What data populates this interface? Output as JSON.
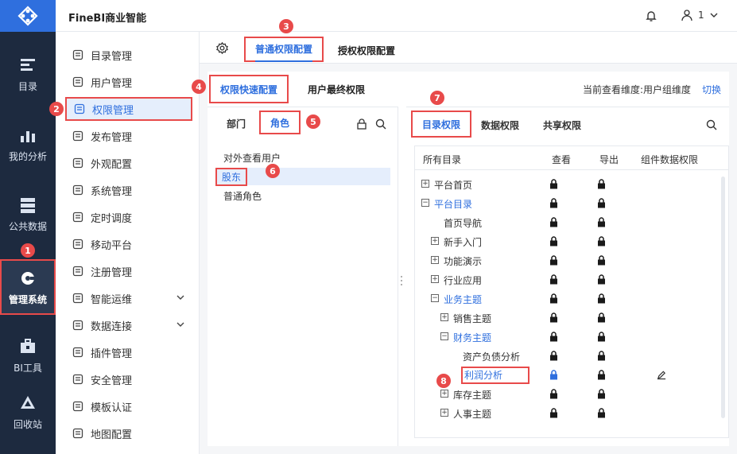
{
  "app": {
    "title": "FineBI商业智能",
    "user": "1"
  },
  "leftnav": [
    {
      "label": "目录",
      "icon": "catalog-icon"
    },
    {
      "label": "我的分析",
      "icon": "analysis-chart-icon"
    },
    {
      "label": "公共数据",
      "icon": "public-data-icon"
    },
    {
      "label": "管理系统",
      "icon": "gear-management-icon"
    },
    {
      "label": "BI工具",
      "icon": "toolbox-icon"
    },
    {
      "label": "回收站",
      "icon": "recycle-icon"
    }
  ],
  "submenu": [
    {
      "label": "目录管理",
      "icon": "catalog-manage-icon"
    },
    {
      "label": "用户管理",
      "icon": "user-icon"
    },
    {
      "label": "权限管理",
      "icon": "permission-shield-icon"
    },
    {
      "label": "发布管理",
      "icon": "publish-icon"
    },
    {
      "label": "外观配置",
      "icon": "appearance-brush-icon"
    },
    {
      "label": "系统管理",
      "icon": "system-gear-icon"
    },
    {
      "label": "定时调度",
      "icon": "timer-icon"
    },
    {
      "label": "移动平台",
      "icon": "mobile-icon"
    },
    {
      "label": "注册管理",
      "icon": "register-icon"
    },
    {
      "label": "智能运维",
      "icon": "ops-icon"
    },
    {
      "label": "数据连接",
      "icon": "link-icon"
    },
    {
      "label": "插件管理",
      "icon": "plugin-icon"
    },
    {
      "label": "安全管理",
      "icon": "security-shield-icon"
    },
    {
      "label": "模板认证",
      "icon": "template-cert-icon"
    },
    {
      "label": "地图配置",
      "icon": "map-icon"
    }
  ],
  "tabs1": {
    "normal": "普通权限配置",
    "grant": "授权权限配置"
  },
  "tabs2": {
    "quick": "权限快速配置",
    "final": "用户最终权限"
  },
  "dimension": {
    "text": "当前查看维度:用户组维度",
    "switch": "切换"
  },
  "lefttabs": {
    "dept": "部门",
    "role": "角色"
  },
  "roles": [
    "对外查看用户",
    "股东",
    "普通角色"
  ],
  "righttabs": {
    "catalog": "目录权限",
    "data": "数据权限",
    "share": "共享权限"
  },
  "treehead": {
    "all": "所有目录",
    "view": "查看",
    "export": "导出",
    "component": "组件数据权限"
  },
  "tree": [
    {
      "label": "平台首页",
      "level": 0,
      "toggle": "+",
      "blue": false
    },
    {
      "label": "平台目录",
      "level": 0,
      "toggle": "-",
      "blue": true
    },
    {
      "label": "首页导航",
      "level": 1,
      "toggle": "",
      "blue": false
    },
    {
      "label": "新手入门",
      "level": 1,
      "toggle": "+",
      "blue": false
    },
    {
      "label": "功能演示",
      "level": 1,
      "toggle": "+",
      "blue": false
    },
    {
      "label": "行业应用",
      "level": 1,
      "toggle": "+",
      "blue": false
    },
    {
      "label": "业务主题",
      "level": 1,
      "toggle": "-",
      "blue": true
    },
    {
      "label": "销售主题",
      "level": 2,
      "toggle": "+",
      "blue": false
    },
    {
      "label": "财务主题",
      "level": 2,
      "toggle": "-",
      "blue": true
    },
    {
      "label": "资产负债分析",
      "level": 3,
      "toggle": "",
      "blue": false
    },
    {
      "label": "利润分析",
      "level": 3,
      "toggle": "",
      "blue": true
    },
    {
      "label": "库存主题",
      "level": 2,
      "toggle": "+",
      "blue": false
    },
    {
      "label": "人事主题",
      "level": 2,
      "toggle": "+",
      "blue": false
    }
  ],
  "badges": [
    "1",
    "2",
    "3",
    "4",
    "5",
    "6",
    "7",
    "8"
  ]
}
